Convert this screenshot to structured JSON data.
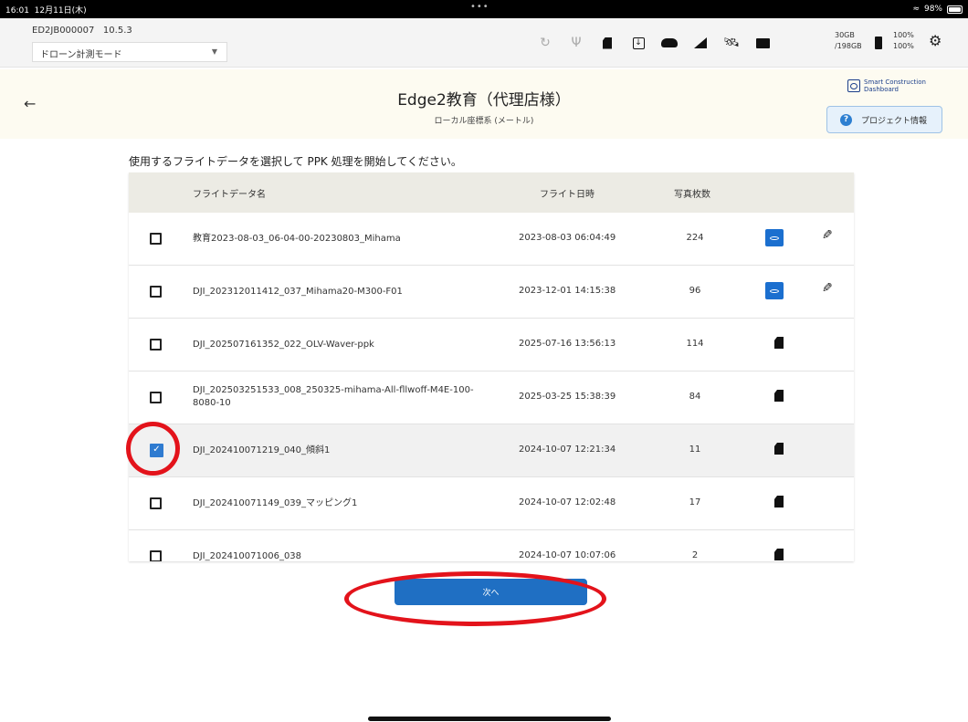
{
  "status_bar": {
    "time": "16:01",
    "date": "12月11日(木)",
    "dots": "•••",
    "battery": "98%"
  },
  "toolbar": {
    "device_id": "ED2JB000007",
    "version": "10.5.3",
    "mode": "ドローン計測モード",
    "storage_used": "30GB",
    "storage_total": "/198GB",
    "battery_1": "100%",
    "battery_2": "100%",
    "icons": [
      "sync-icon",
      "usb-icon",
      "sd-card-icon",
      "download-icon",
      "cloud-icon",
      "signal-icon",
      "satellite-icon",
      "folder-icon",
      "battery-icon",
      "gear-icon"
    ]
  },
  "header": {
    "back": "←",
    "title": "Edge2教育（代理店様）",
    "subtitle": "ローカル座標系 (メートル)",
    "brand_line1": "Smart Construction",
    "brand_line2": "Dashboard",
    "project_info": "プロジェクト情報"
  },
  "instruction": "使用するフライトデータを選択して PPK 処理を開始してください。",
  "table": {
    "columns": {
      "name": "フライトデータ名",
      "date": "フライト日時",
      "count": "写真枚数"
    },
    "rows": [
      {
        "name": "教育2023-08-03_06-04-00-20230803_Mihama",
        "date": "2023-08-03 06:04:49",
        "count": "224",
        "checked": false,
        "source": "cloud",
        "editable": true
      },
      {
        "name": "DJI_202312011412_037_Mihama20-M300-F01",
        "date": "2023-12-01 14:15:38",
        "count": "96",
        "checked": false,
        "source": "cloud",
        "editable": true
      },
      {
        "name": "DJI_202507161352_022_OLV-Waver-ppk",
        "date": "2025-07-16 13:56:13",
        "count": "114",
        "checked": false,
        "source": "sd",
        "editable": false
      },
      {
        "name": "DJI_202503251533_008_250325-mihama-All-fllwoff-M4E-100-8080-10",
        "date": "2025-03-25 15:38:39",
        "count": "84",
        "checked": false,
        "source": "sd",
        "editable": false
      },
      {
        "name": "DJI_202410071219_040_傾斜1",
        "date": "2024-10-07 12:21:34",
        "count": "11",
        "checked": true,
        "source": "sd",
        "editable": false
      },
      {
        "name": "DJI_202410071149_039_マッピング1",
        "date": "2024-10-07 12:02:48",
        "count": "17",
        "checked": false,
        "source": "sd",
        "editable": false
      },
      {
        "name": "DJI_202410071006_038",
        "date": "2024-10-07 10:07:06",
        "count": "2",
        "checked": false,
        "source": "sd",
        "editable": false
      }
    ]
  },
  "next_button": "次へ",
  "colors": {
    "accent": "#1f6fc3",
    "annotation": "#e3131b",
    "header_bg": "#fdfbf1"
  }
}
